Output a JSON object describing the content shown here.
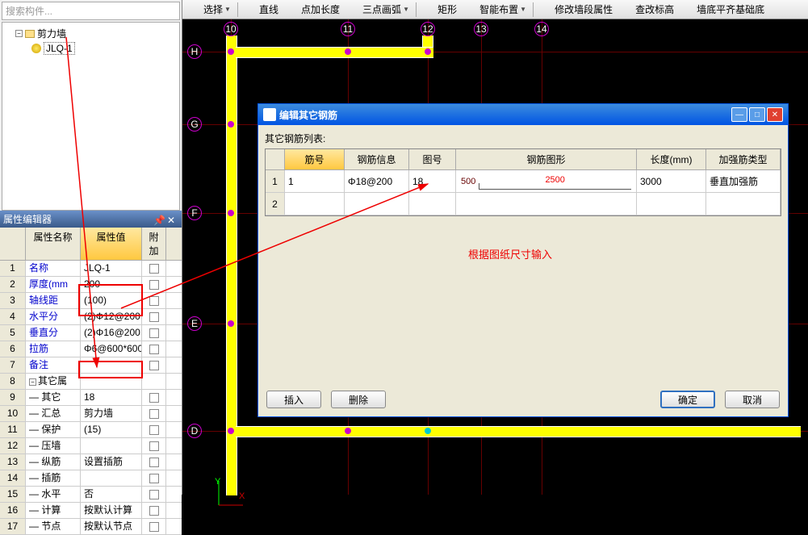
{
  "search_placeholder": "搜索构件...",
  "tree": {
    "root": "剪力墙",
    "child": "JLQ-1"
  },
  "prop_panel": {
    "title": "属性编辑器",
    "headers": {
      "name": "属性名称",
      "value": "属性值",
      "extra": "附加"
    }
  },
  "props": [
    {
      "n": "1",
      "name": "名称",
      "val": "JLQ-1",
      "blue": true
    },
    {
      "n": "2",
      "name": "厚度(mm",
      "val": "200",
      "blue": true
    },
    {
      "n": "3",
      "name": "轴线距",
      "val": "(100)",
      "blue": true
    },
    {
      "n": "4",
      "name": "水平分",
      "val": "(2)Φ12@200",
      "blue": true,
      "hl": true
    },
    {
      "n": "5",
      "name": "垂直分",
      "val": "(2)Φ16@200",
      "blue": true,
      "hl": true
    },
    {
      "n": "6",
      "name": "拉筋",
      "val": "Φ6@600*600",
      "blue": true
    },
    {
      "n": "7",
      "name": "备注",
      "val": "",
      "blue": true
    },
    {
      "n": "8",
      "name": "其它属",
      "val": "",
      "group": true
    },
    {
      "n": "9",
      "name": "— 其它",
      "val": "18",
      "hl2": true
    },
    {
      "n": "10",
      "name": "— 汇总",
      "val": "剪力墙"
    },
    {
      "n": "11",
      "name": "— 保护",
      "val": "(15)"
    },
    {
      "n": "12",
      "name": "— 压墙",
      "val": ""
    },
    {
      "n": "13",
      "name": "— 纵筋",
      "val": "设置插筋"
    },
    {
      "n": "14",
      "name": "— 插筋",
      "val": ""
    },
    {
      "n": "15",
      "name": "— 水平",
      "val": "否"
    },
    {
      "n": "16",
      "name": "— 计算",
      "val": "按默认计算设"
    },
    {
      "n": "17",
      "name": "— 节点",
      "val": "按默认节点设"
    }
  ],
  "toolbar": [
    {
      "icon": "cursor",
      "label": "选择",
      "dd": true
    },
    {
      "sep": true
    },
    {
      "icon": "line",
      "label": "直线"
    },
    {
      "icon": "point",
      "label": "点加长度"
    },
    {
      "icon": "arc",
      "label": "三点画弧",
      "dd": true
    },
    {
      "sep": true
    },
    {
      "icon": "rect",
      "label": "矩形"
    },
    {
      "icon": "smart",
      "label": "智能布置",
      "dd": true
    },
    {
      "sep": true
    },
    {
      "icon": "edit",
      "label": "修改墙段属性"
    },
    {
      "icon": "elev",
      "label": "查改标高"
    },
    {
      "icon": "base",
      "label": "墙底平齐基础底"
    }
  ],
  "dialog": {
    "title": "编辑其它钢筋",
    "list_label": "其它钢筋列表:",
    "headers": {
      "c1": "筋号",
      "c2": "钢筋信息",
      "c3": "图号",
      "c4": "钢筋图形",
      "c5": "长度(mm)",
      "c6": "加强筋类型"
    },
    "rows": [
      {
        "n": "1",
        "c1": "1",
        "c2": "Φ18@200",
        "c3": "18",
        "shape_l": "500",
        "shape_m": "2500",
        "c5": "3000",
        "c6": "垂直加强筋"
      },
      {
        "n": "2",
        "c1": "",
        "c2": "",
        "c3": "",
        "shape_l": "",
        "shape_m": "",
        "c5": "",
        "c6": ""
      }
    ],
    "annotation": "根据图纸尺寸输入",
    "buttons": {
      "insert": "插入",
      "delete": "删除",
      "ok": "确定",
      "cancel": "取消"
    }
  },
  "axes": {
    "v_labels": [
      "10",
      "11",
      "12",
      "13",
      "14"
    ],
    "h_labels": [
      "H",
      "G",
      "F",
      "E",
      "D"
    ],
    "coord_y": "Y",
    "coord_x": "X"
  }
}
